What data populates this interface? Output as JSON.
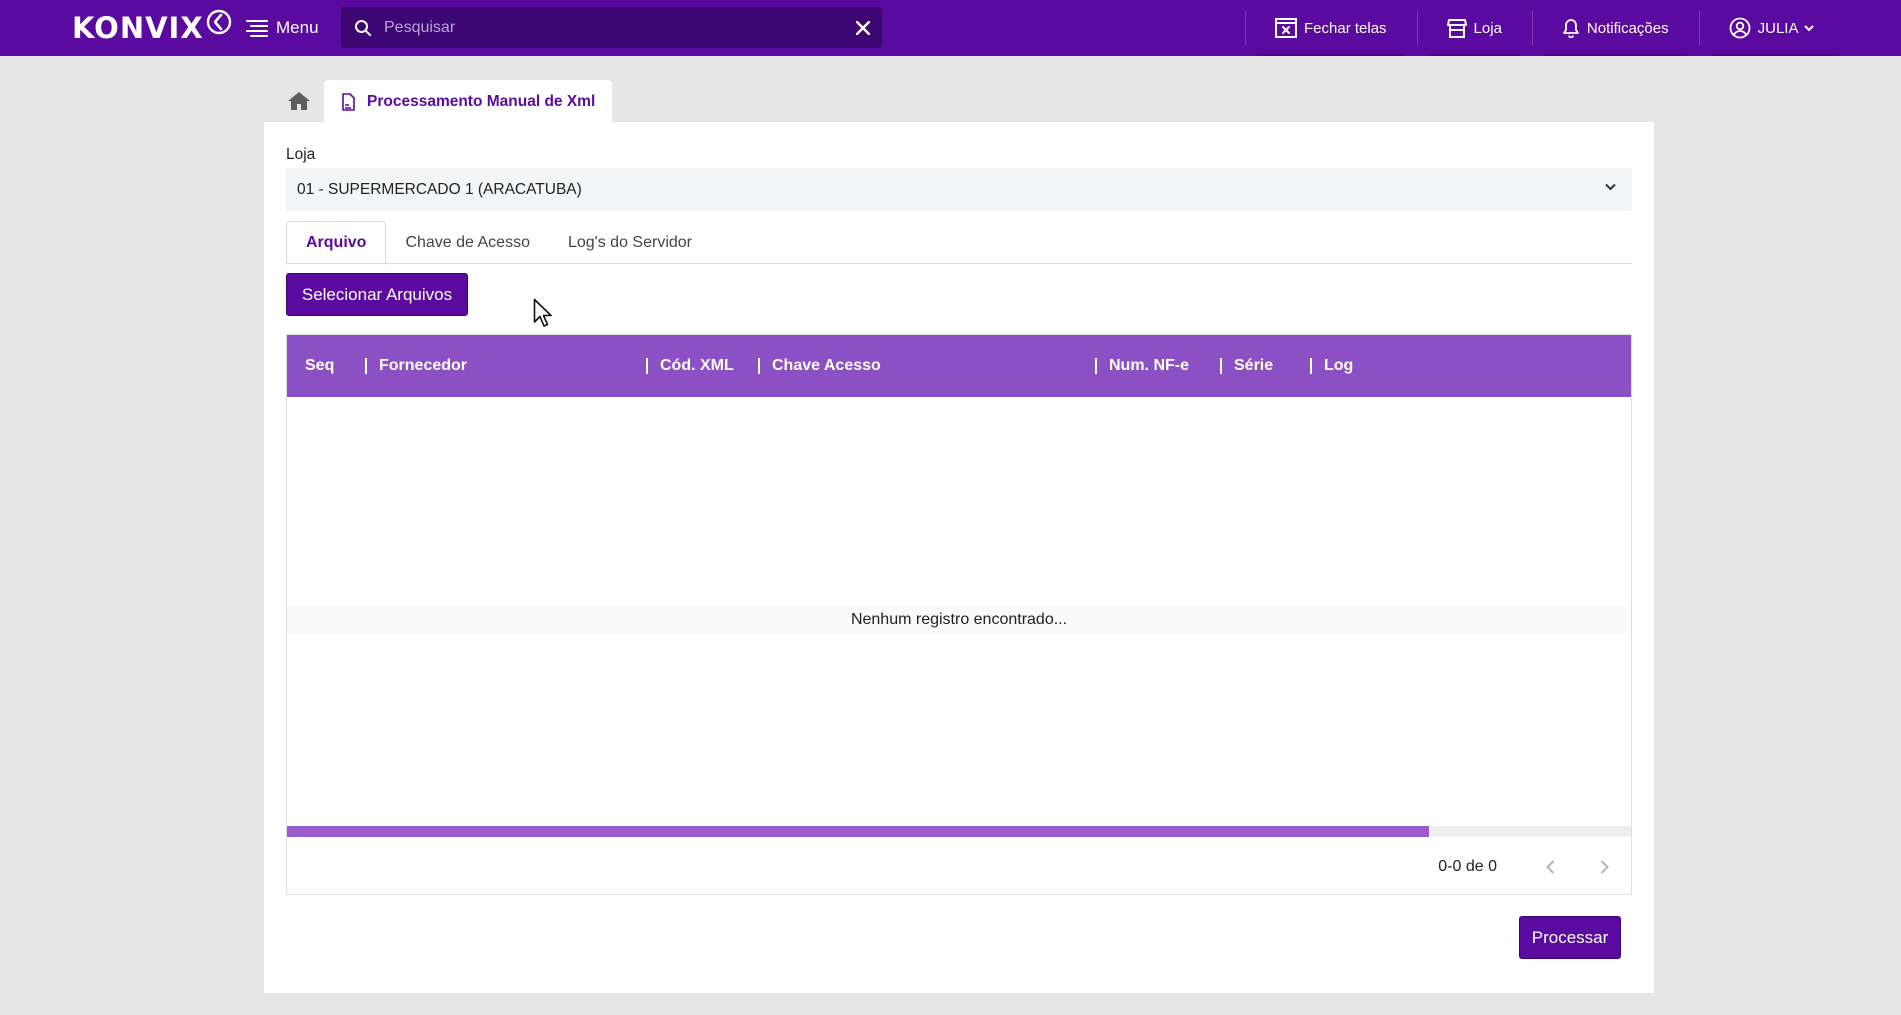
{
  "topbar": {
    "logo_text": "KONVIX",
    "menu_label": "Menu",
    "search_placeholder": "Pesquisar",
    "actions": {
      "close_screens": "Fechar telas",
      "store": "Loja",
      "notifications": "Notificações",
      "user": "JULIA"
    }
  },
  "tabs_nav": {
    "page_tab": "Processamento Manual de Xml"
  },
  "form": {
    "store_label": "Loja",
    "store_value": "01 - SUPERMERCADO 1 (ARACATUBA)"
  },
  "tabs": [
    {
      "label": "Arquivo",
      "active": true
    },
    {
      "label": "Chave de Acesso",
      "active": false
    },
    {
      "label": "Log's do Servidor",
      "active": false
    }
  ],
  "select_files_button": "Selecionar Arquivos",
  "grid": {
    "columns": [
      "Seq",
      "Fornecedor",
      "Cód. XML",
      "Chave Acesso",
      "Num. NF-e",
      "Série",
      "Log"
    ],
    "empty_message": "Nenhum registro encontrado...",
    "pagination": "0-0 de 0",
    "scroll_fraction": 0.85
  },
  "process_button": "Processar",
  "colors": {
    "brand": "#5a0a9e",
    "grid_header": "#8b50c4"
  }
}
